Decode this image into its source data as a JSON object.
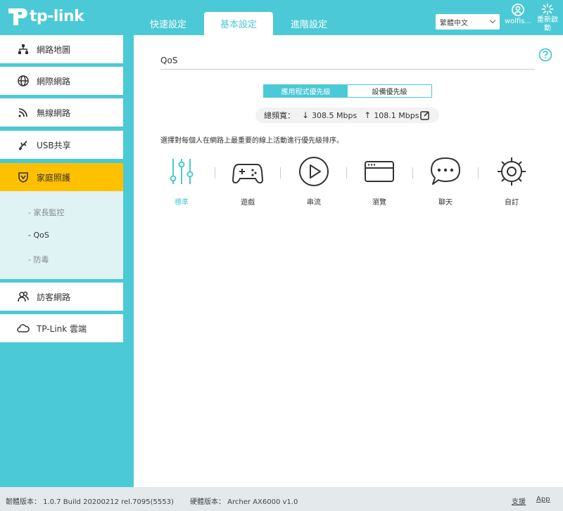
{
  "header": {
    "logo_text": "tp-link",
    "tabs": [
      {
        "label": "快速設定"
      },
      {
        "label": "基本設定"
      },
      {
        "label": "進階設定"
      }
    ],
    "language": "繁體中文",
    "user_label": "wolfis...",
    "reboot_label": "重新啟動"
  },
  "sidebar": {
    "items": [
      {
        "label": "網路地圖"
      },
      {
        "label": "網際網路"
      },
      {
        "label": "無線網路"
      },
      {
        "label": "USB共享"
      },
      {
        "label": "家庭照護"
      },
      {
        "label": "訪客網路"
      },
      {
        "label": "TP-Link 雲端"
      }
    ],
    "sub_items": [
      {
        "label": "- 家長監控"
      },
      {
        "label": "- QoS"
      },
      {
        "label": "- 防毒"
      }
    ]
  },
  "main": {
    "title": "QoS",
    "segments": [
      {
        "label": "應用程式優先級"
      },
      {
        "label": "設備優先級"
      }
    ],
    "bandwidth": {
      "label": "總頻寬：",
      "down": "308.5 Mbps",
      "up": "108.1 Mbps"
    },
    "description": "選擇對每個人在網路上最重要的線上活動進行優先級排序。",
    "modes": [
      {
        "label": "標準"
      },
      {
        "label": "遊戲"
      },
      {
        "label": "串流"
      },
      {
        "label": "瀏覽"
      },
      {
        "label": "聊天"
      },
      {
        "label": "自訂"
      }
    ]
  },
  "footer": {
    "firmware": "韌體版本： 1.0.7 Build 20200212 rel.7095(5553)",
    "hardware": "硬體版本： Archer AX6000 v1.0",
    "support": "支援",
    "app": "App"
  },
  "colors": {
    "accent": "#4bc9d6",
    "active_menu": "#ffc000",
    "icon": "#333333"
  }
}
